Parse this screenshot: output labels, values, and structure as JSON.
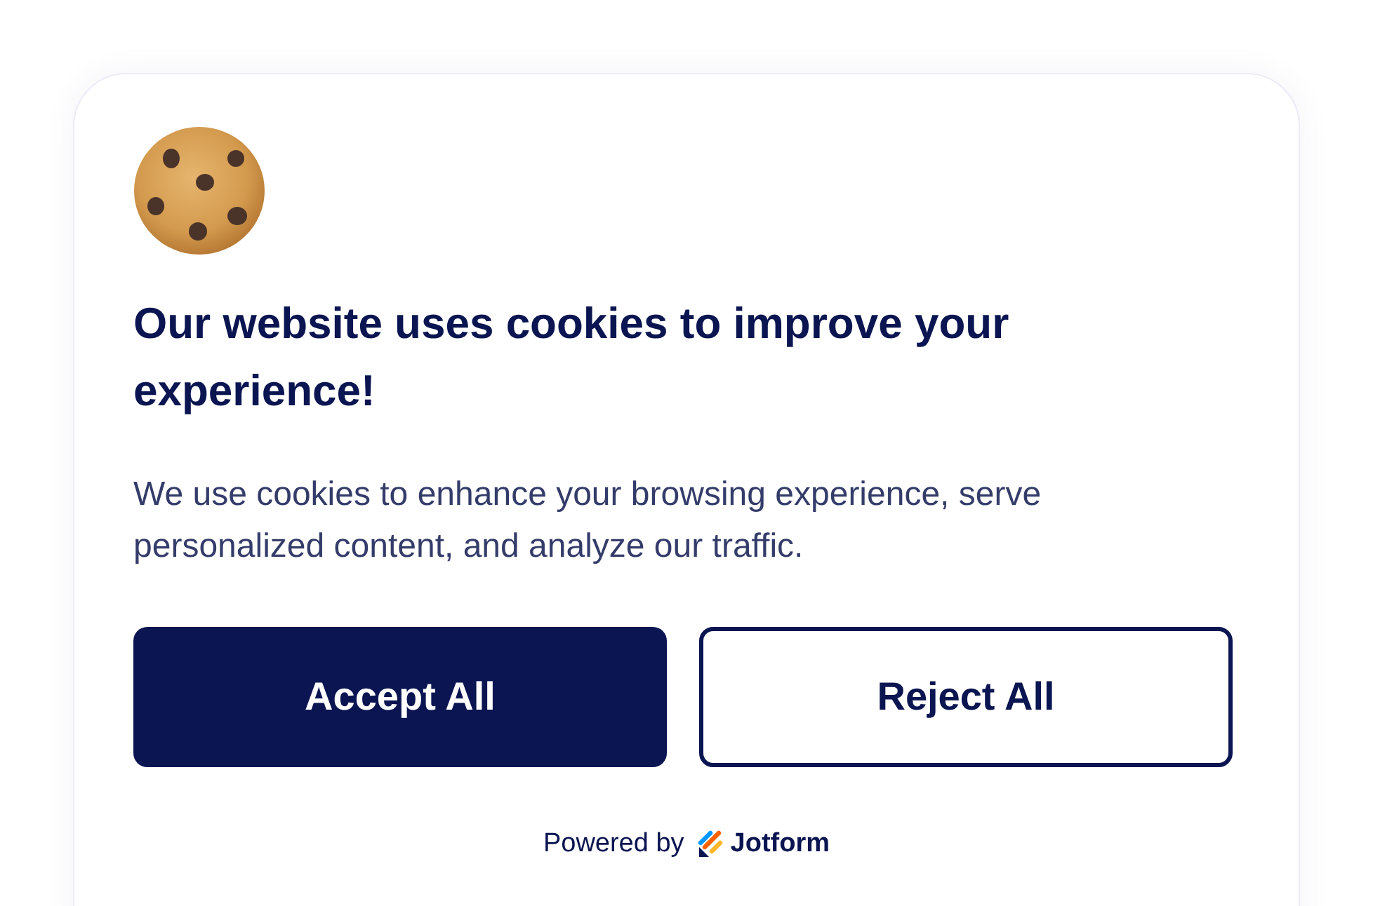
{
  "banner": {
    "heading": "Our website uses cookies to improve your experience!",
    "description": "We use cookies to enhance your browsing experience, serve personalized content, and analyze our traffic.",
    "buttons": [
      {
        "label": "Accept All",
        "kind": "primary"
      },
      {
        "label": "Reject All",
        "kind": "secondary"
      }
    ],
    "footer": {
      "powered_by": "Powered by",
      "brand": "Jotform"
    }
  }
}
